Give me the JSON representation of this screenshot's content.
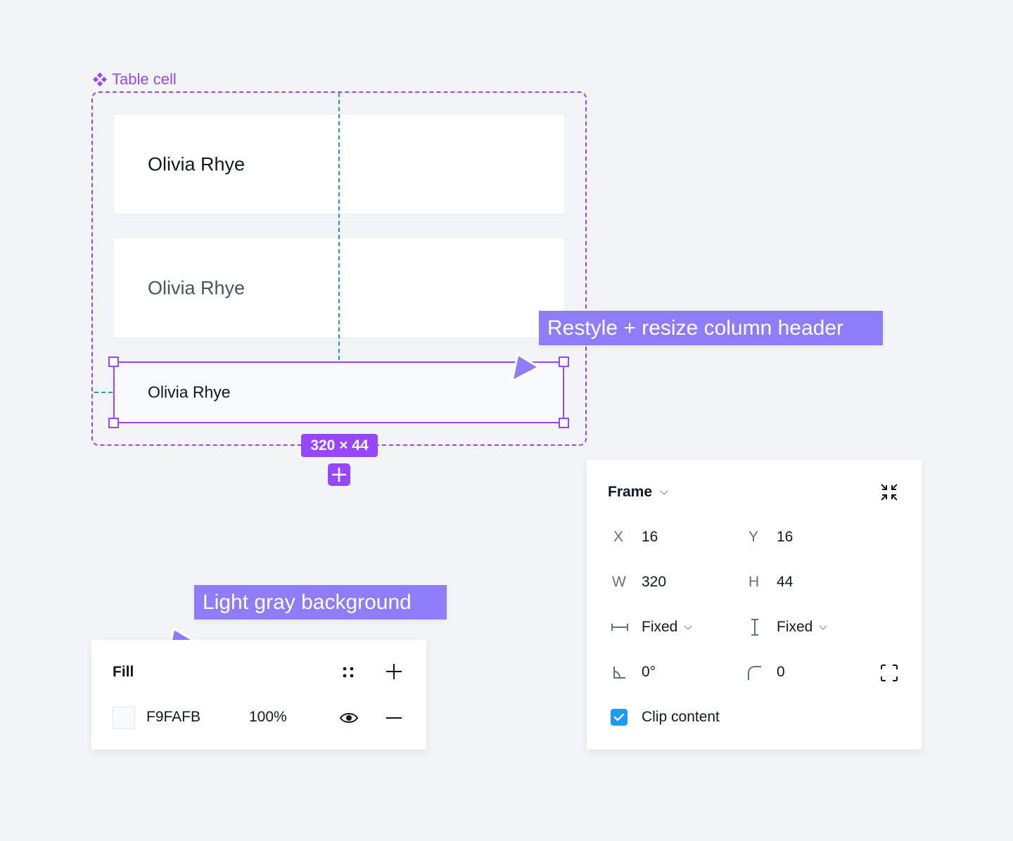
{
  "component": {
    "label": "Table cell",
    "icon": "component-icon",
    "accent_color": "#9747FF",
    "guide_color": "#1D9BC6"
  },
  "cells": [
    {
      "text": "Olivia Rhye",
      "style": "regular-dark"
    },
    {
      "text": "Olivia Rhye",
      "style": "regular-gray"
    }
  ],
  "selected_cell": {
    "text": "Olivia Rhye",
    "size_badge": "320 × 44",
    "add_icon": "plus-icon"
  },
  "callouts": [
    {
      "text": "Restyle + resize column header",
      "color": "#8E7CFB"
    },
    {
      "text": "Light gray background",
      "color": "#8E7CFB"
    }
  ],
  "fill_panel": {
    "title": "Fill",
    "style_icon": "styles-dots-icon",
    "add_icon": "plus-icon",
    "swatch_color": "#F9FAFB",
    "hex": "F9FAFB",
    "opacity": "100%",
    "visibility_icon": "eye-icon",
    "remove_icon": "minus-icon"
  },
  "frame_panel": {
    "title": "Frame",
    "x_label": "X",
    "x_value": "16",
    "y_label": "Y",
    "y_value": "16",
    "w_label": "W",
    "w_value": "320",
    "h_label": "H",
    "h_value": "44",
    "width_sizing": "Fixed",
    "height_sizing": "Fixed",
    "rotation": "0°",
    "corner_radius": "0",
    "clip_content_label": "Clip content",
    "clip_content_checked": true,
    "checkbox_color": "#1A9BF4"
  }
}
